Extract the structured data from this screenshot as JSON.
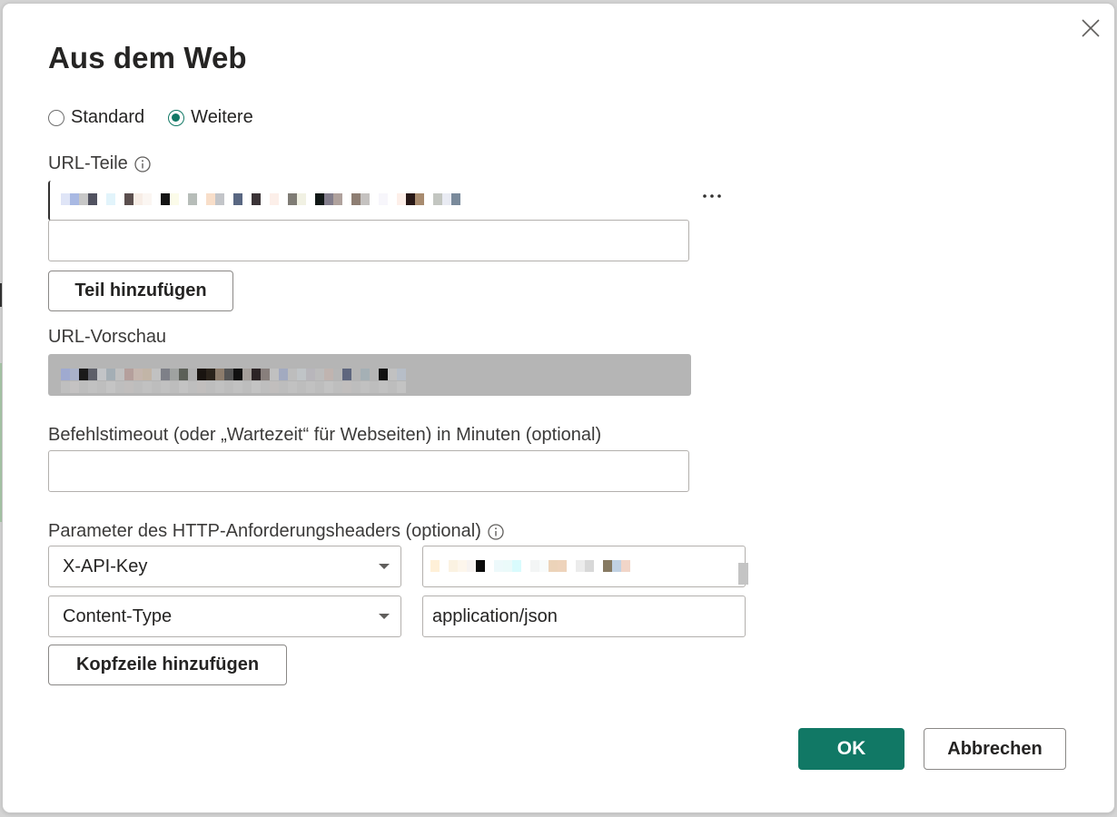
{
  "dialog": {
    "title": "Aus dem Web",
    "mode": {
      "options": [
        {
          "label": "Standard",
          "selected": false
        },
        {
          "label": "Weitere",
          "selected": true
        }
      ]
    },
    "url_parts": {
      "label": "URL-Teile",
      "parts": [
        "",
        ""
      ],
      "add_part_label": "Teil hinzufügen"
    },
    "url_preview": {
      "label": "URL-Vorschau"
    },
    "timeout": {
      "label": "Befehlstimeout (oder „Wartezeit“ für Webseiten) in Minuten (optional)",
      "value": ""
    },
    "http_headers": {
      "label": "Parameter des HTTP-Anforderungsheaders (optional)",
      "rows": [
        {
          "name": "X-API-Key",
          "value": ""
        },
        {
          "name": "Content-Type",
          "value": "application/json"
        }
      ],
      "add_header_label": "Kopfzeile hinzufügen"
    },
    "ok_label": "OK",
    "cancel_label": "Abbrechen"
  },
  "colors": {
    "accent": "#117865",
    "preview_background": "#b5b5b5"
  },
  "icons": {
    "close": "close-icon",
    "info": "info-icon",
    "more": "more-icon",
    "dropdown": "chevron-down-icon"
  }
}
